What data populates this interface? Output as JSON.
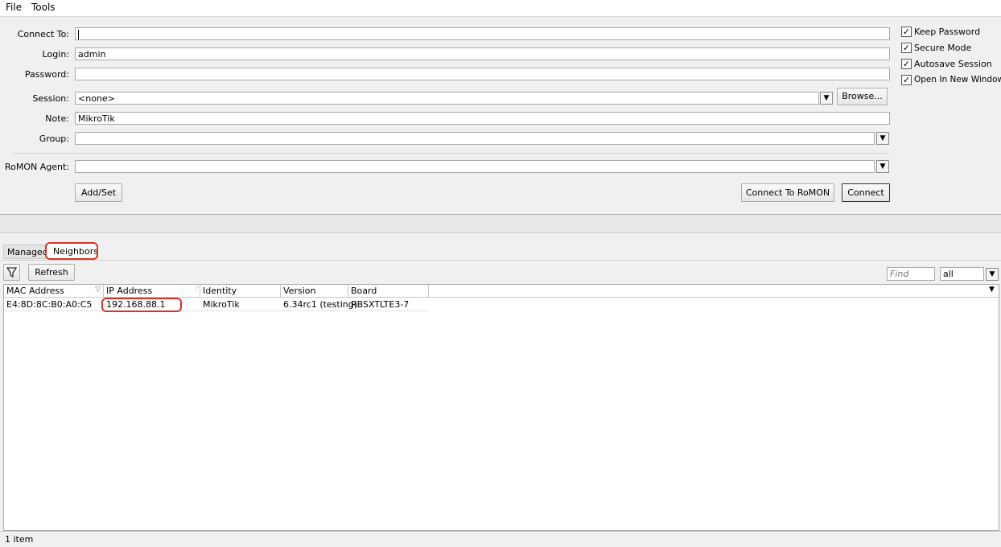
{
  "menu": {
    "file": "File",
    "tools": "Tools"
  },
  "form": {
    "connect_to_label": "Connect To:",
    "connect_to_value": "",
    "login_label": "Login:",
    "login_value": "admin",
    "password_label": "Password:",
    "password_value": "",
    "session_label": "Session:",
    "session_value": "<none>",
    "browse_label": "Browse...",
    "note_label": "Note:",
    "note_value": "MikroTik",
    "group_label": "Group:",
    "group_value": "",
    "romon_label": "RoMON Agent:",
    "romon_value": "",
    "add_set_label": "Add/Set",
    "connect_romon_label": "Connect To RoMON",
    "connect_label": "Connect"
  },
  "options": [
    {
      "label": "Keep Password",
      "checked": true
    },
    {
      "label": "Secure Mode",
      "checked": true
    },
    {
      "label": "Autosave Session",
      "checked": true
    },
    {
      "label": "Open In New Window",
      "checked": true
    }
  ],
  "tabs": {
    "managed": "Managed",
    "neighbors": "Neighbors"
  },
  "toolbar": {
    "refresh": "Refresh",
    "find_placeholder": "Find",
    "filter_value": "all"
  },
  "table": {
    "columns": [
      "MAC Address",
      "IP Address",
      "Identity",
      "Version",
      "Board"
    ],
    "rows": [
      {
        "mac": "E4:8D:8C:B0:A0:C5",
        "ip": "192.168.88.1",
        "identity": "MikroTik",
        "version": "6.34rc1 (testing)",
        "board": "RBSXTLTE3-7"
      }
    ]
  },
  "status": {
    "count": "1 item"
  },
  "colors": {
    "highlight": "#d9322a"
  }
}
